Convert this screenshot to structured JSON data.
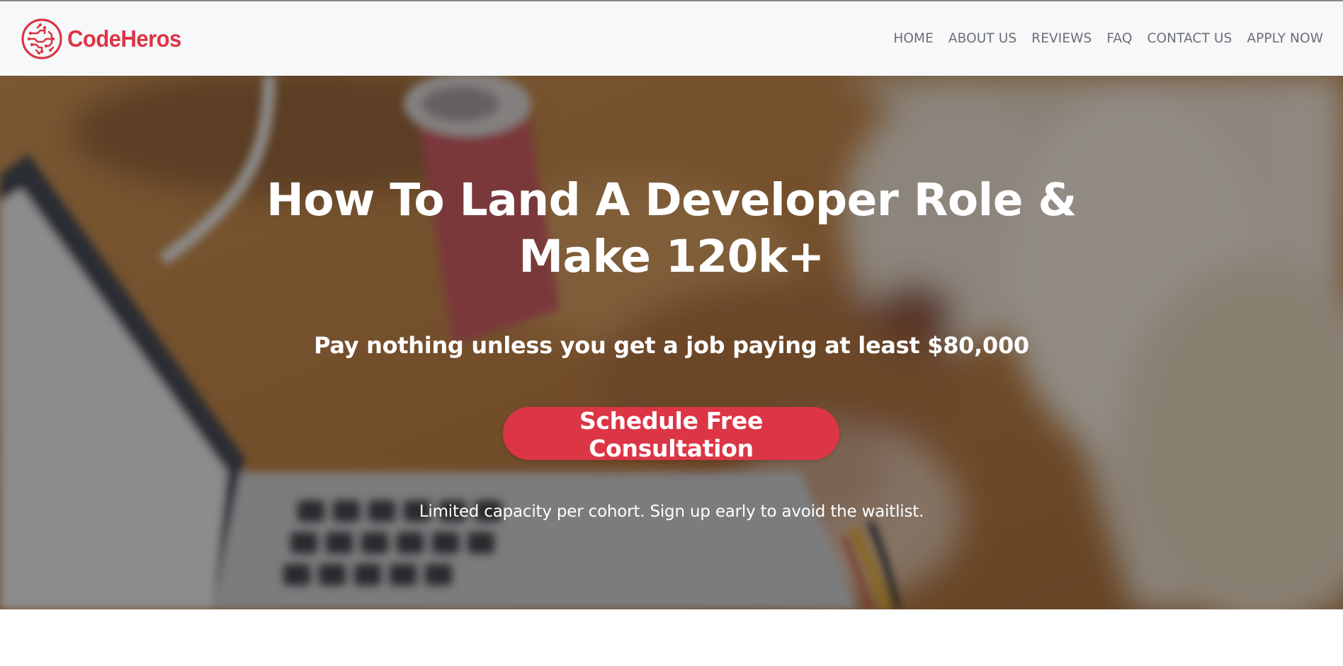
{
  "brand": {
    "name": "CodeHeros",
    "logo_icon": "circuit-logo-icon",
    "color": "#dc3545"
  },
  "nav": {
    "items": [
      {
        "label": "HOME"
      },
      {
        "label": "ABOUT US"
      },
      {
        "label": "REVIEWS"
      },
      {
        "label": "FAQ"
      },
      {
        "label": "CONTACT US"
      },
      {
        "label": "APPLY NOW"
      }
    ]
  },
  "hero": {
    "title": "How To Land A Developer Role & Make 120k+",
    "subtitle": "Pay nothing unless you get a job paying at least $80,000",
    "cta_label": "Schedule Free Consultation",
    "note": "Limited capacity per cohort. Sign up early to avoid the waitlist.",
    "background": "blurred photo of a person typing on a laptop at a wooden desk with a soda can",
    "cta_color": "#dc3545"
  }
}
